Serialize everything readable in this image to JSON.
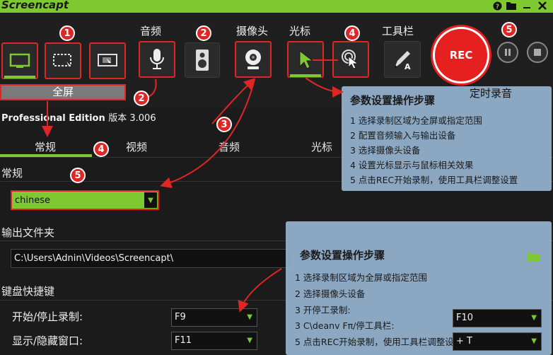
{
  "app": {
    "title": "Screencapt"
  },
  "titlebar": {
    "help_icon": "?",
    "folder_icon": "folder",
    "minimize_icon": "minus",
    "close_icon": "x"
  },
  "toolbar": {
    "audio_label": "音频",
    "camera_label": "摄像头",
    "cursor_label": "光标",
    "tools_label": "工具栏",
    "fullscreen_label": "全屏",
    "rec_label": "REC",
    "timer_label": "定时录音"
  },
  "badges": {
    "b1": "1",
    "b2": "2",
    "b3": "3",
    "b4": "4",
    "b5": "5"
  },
  "edition": {
    "name": "Professional Edition",
    "version": "版本 3.006"
  },
  "tabs": [
    "常规",
    "视频",
    "音频",
    "光标"
  ],
  "general": {
    "section": "常规",
    "language_value": "chinese"
  },
  "output": {
    "section": "输出文件夹",
    "path": "C:\\Users\\Adnin\\Videos\\Screencapt\\"
  },
  "hotkeys": {
    "section": "键盘快捷键",
    "rows": [
      {
        "label": "开始/停止录制:",
        "value": "F9"
      },
      {
        "label": "显示/隐藏窗口:",
        "value": "F11"
      }
    ]
  },
  "panel_top": {
    "title": "参数设置操作步骤",
    "items": [
      "1 选择录制区域为全屏或指定范围",
      "2 配置音频输入与输出设备",
      "3 选择摄像头设备",
      "4 设置光标显示与鼠标相关效果",
      "5 点击REC开始录制，使用工具栏调整设置"
    ]
  },
  "panel_bottom": {
    "title": "参数设置操作步骤",
    "items": [
      "1 选择录制区域为全屏或指定范围",
      "2 选择摄像头设备",
      "3 开停工录制:",
      "3 C\\deanv Fπ/停工具栏:",
      "5 点击REC开始录制，使用工具栏调整设置"
    ],
    "select_value": "F10",
    "plus_value": "+ T"
  },
  "colors": {
    "accent": "#7ec832",
    "annotation_red": "#e02525",
    "panel": "#93b2cd"
  }
}
